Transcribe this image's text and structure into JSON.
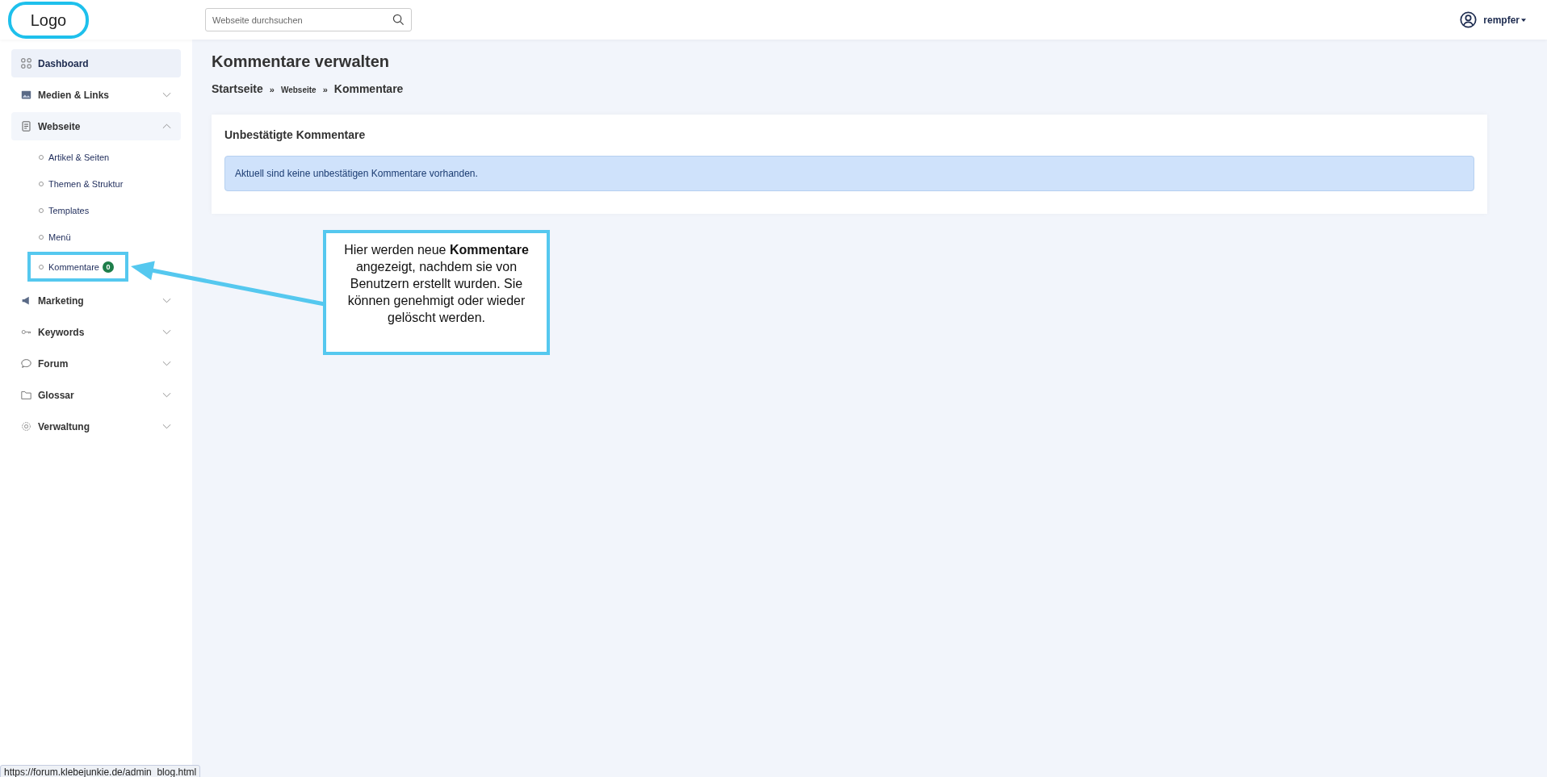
{
  "header": {
    "logo": "Logo",
    "search": {
      "placeholder": "Webseite durchsuchen"
    },
    "user": "rempfer"
  },
  "sidebar": {
    "items": [
      {
        "label": "Dashboard",
        "selected": true
      },
      {
        "label": "Medien & Links",
        "selected": false,
        "expanded": false
      },
      {
        "label": "Webseite",
        "selected": false,
        "expanded": true,
        "children": [
          {
            "label": "Artikel & Seiten",
            "highlighted": false
          },
          {
            "label": "Themen & Struktur",
            "highlighted": false
          },
          {
            "label": "Templates",
            "highlighted": false
          },
          {
            "label": "Menü",
            "highlighted": false
          },
          {
            "label": "Kommentare",
            "badge": "0",
            "highlighted": true
          }
        ]
      },
      {
        "label": "Marketing",
        "selected": false,
        "expanded": false
      },
      {
        "label": "Keywords",
        "selected": false,
        "expanded": false
      },
      {
        "label": "Forum",
        "selected": false,
        "expanded": false
      },
      {
        "label": "Glossar",
        "selected": false,
        "expanded": false
      },
      {
        "label": "Verwaltung",
        "selected": false,
        "expanded": false
      }
    ]
  },
  "page": {
    "title": "Kommentare verwalten",
    "breadcrumb": [
      "Startseite",
      "Webseite",
      "Kommentare"
    ],
    "separator": "»",
    "card": {
      "title": "Unbestätigte Kommentare",
      "alert": "Aktuell sind keine unbestätigen Kommentare vorhanden."
    }
  },
  "callout": "Hier werden neue **Kommentare** angezeigt, nachdem sie von Benutzern erstellt wurden. Sie können genehmigt oder wieder gelöscht werden.",
  "status_bar": {
    "url": "https://forum.klebejunkie.de/admin_blog.html"
  }
}
